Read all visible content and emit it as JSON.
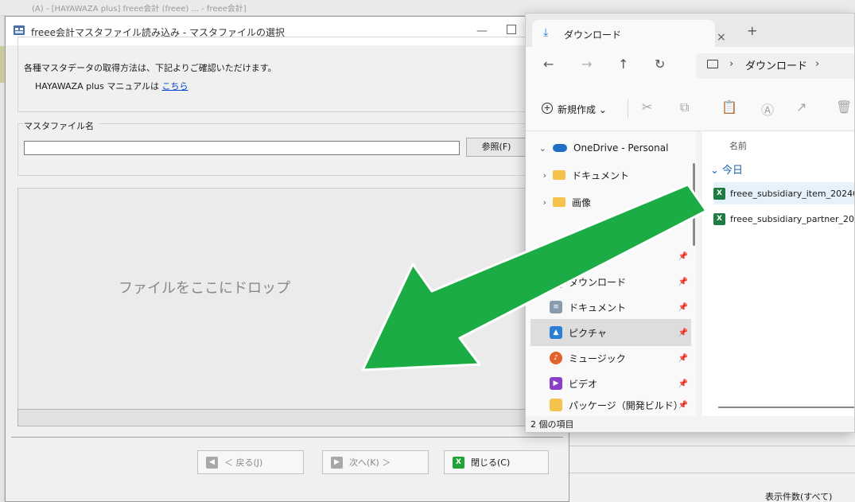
{
  "background": {
    "top_strip_text": "(A) - [HAYAWAZA plus] freee会計 (freee) ... - freee会計]",
    "record_count_label": "表示件数(すべて)"
  },
  "dialog": {
    "title": "freee会計マスタファイル読み込み - マスタファイルの選択",
    "info_line1": "各種マスタデータの取得方法は、下記よりご確認いただけます。",
    "info_line2_prefix": "HAYAWAZA plus マニュアルは ",
    "info_link": "こちら",
    "file_group_label": "マスタファイル名",
    "file_input_value": "",
    "browse_label": "参照(F)",
    "drop_text": "ファイルをここにドロップ",
    "back_label": "＜ 戻る(J)",
    "next_label": "次へ(K) ＞",
    "close_label": "閉じる(C)"
  },
  "explorer": {
    "tab_label": "ダウンロード",
    "tab_close": "×",
    "new_tab": "+",
    "address": {
      "separator": "›",
      "path": "ダウンロード"
    },
    "toolbar": {
      "new_label": "新規作成 ⌄"
    },
    "tree": [
      {
        "chevron": "⌄",
        "label": "OneDrive - Personal"
      },
      {
        "chevron": "›",
        "label": "ドキュメント"
      },
      {
        "chevron": "›",
        "label": "画像"
      }
    ],
    "quick_access": [
      {
        "label": "ダウンロード"
      },
      {
        "label": "ドキュメント"
      },
      {
        "label": "ピクチャ"
      },
      {
        "label": "ミュージック"
      },
      {
        "label": "ビデオ"
      },
      {
        "label": "パッケージ（開発ビルド）"
      }
    ],
    "column_name": "名前",
    "group_today": "⌄ 今日",
    "files": [
      {
        "name": "freee_subsidiary_item_20240"
      },
      {
        "name": "freee_subsidiary_partner_20"
      }
    ],
    "status": "2 個の項目"
  },
  "overlay": {
    "arrow_color": "#1cac45",
    "arrow_outline": "#ffffff"
  }
}
